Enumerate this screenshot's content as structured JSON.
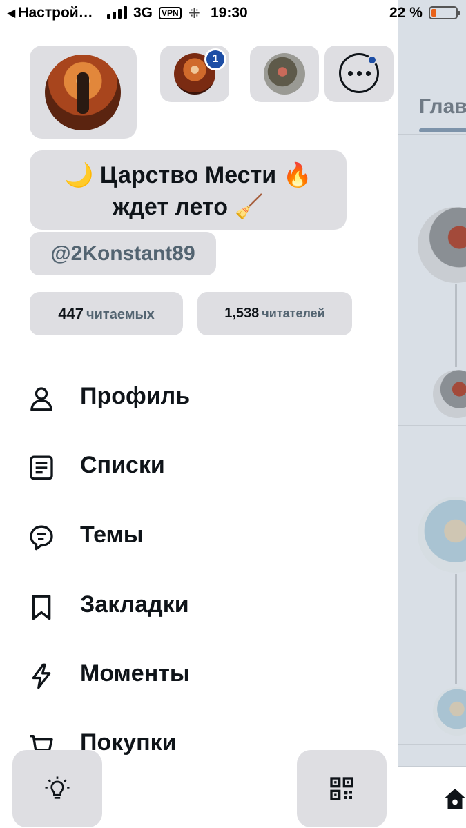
{
  "status_bar": {
    "back_label": "Настрой…",
    "network": "3G",
    "vpn": "VPN",
    "time": "19:30",
    "battery": "22 %",
    "battery_level": 0.22
  },
  "profile": {
    "display_name_line1": "🌙 Царство Мести 🔥",
    "display_name_line2": "ждет лето 🧹",
    "handle": "@2Konstant89",
    "following_count": "447",
    "following_label": "читаемых",
    "followers_count": "1,538",
    "followers_label": "читателей",
    "account_badge_count": "1"
  },
  "menu": {
    "items": [
      {
        "label": "Профиль",
        "icon": "person-icon"
      },
      {
        "label": "Списки",
        "icon": "list-icon"
      },
      {
        "label": "Темы",
        "icon": "topics-icon"
      },
      {
        "label": "Закладки",
        "icon": "bookmark-icon"
      },
      {
        "label": "Моменты",
        "icon": "lightning-icon"
      },
      {
        "label": "Покупки",
        "icon": "cart-icon"
      }
    ]
  },
  "bottom_buttons": {
    "left_icon": "lightbulb-icon",
    "right_icon": "qr-code-icon"
  },
  "background_timeline": {
    "tab_label": "Главная",
    "bottom_icon": "home-icon"
  },
  "colors": {
    "tile_bg": "#dedee2",
    "accent": "#1d4ea5",
    "text_primary": "#0f1419",
    "text_secondary": "#536471"
  }
}
